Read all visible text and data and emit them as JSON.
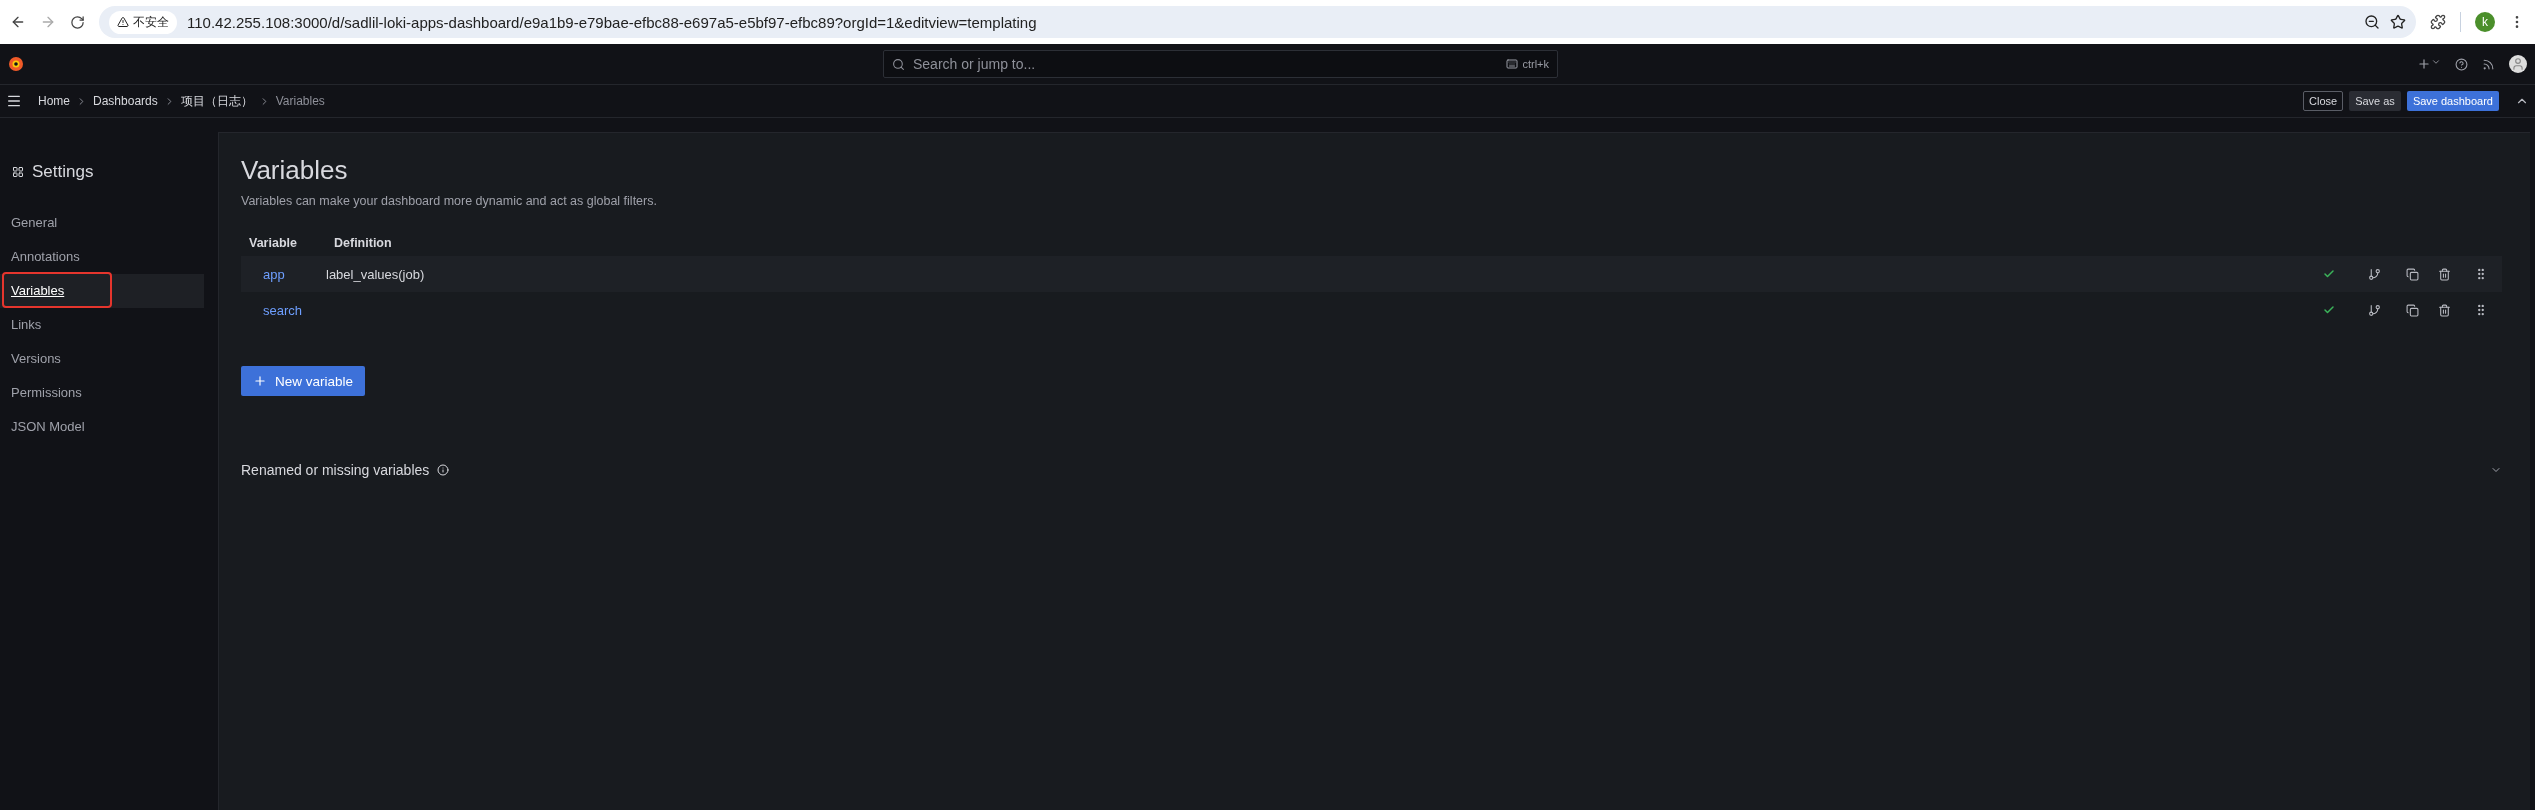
{
  "browser": {
    "security_label": "不安全",
    "url": "110.42.255.108:3000/d/sadlil-loki-apps-dashboard/e9a1b9-e79bae-efbc88-e697a5-e5bf97-efbc89?orgId=1&editview=templating",
    "profile_initial": "k"
  },
  "topbar": {
    "search_placeholder": "Search or jump to...",
    "shortcut": "ctrl+k"
  },
  "breadcrumbs": [
    {
      "label": "Home",
      "current": false
    },
    {
      "label": "Dashboards",
      "current": false
    },
    {
      "label": "项目（日志）",
      "current": false
    },
    {
      "label": "Variables",
      "current": true
    }
  ],
  "actions": [
    {
      "label": "Close",
      "kind": "outline"
    },
    {
      "label": "Save as",
      "kind": "secondary"
    },
    {
      "label": "Save dashboard",
      "kind": "primary"
    }
  ],
  "sidebar": {
    "title": "Settings",
    "items": [
      {
        "label": "General",
        "selected": false,
        "highlighted": false
      },
      {
        "label": "Annotations",
        "selected": false,
        "highlighted": false
      },
      {
        "label": "Variables",
        "selected": true,
        "highlighted": true
      },
      {
        "label": "Links",
        "selected": false,
        "highlighted": false
      },
      {
        "label": "Versions",
        "selected": false,
        "highlighted": false
      },
      {
        "label": "Permissions",
        "selected": false,
        "highlighted": false
      },
      {
        "label": "JSON Model",
        "selected": false,
        "highlighted": false
      }
    ]
  },
  "page": {
    "title": "Variables",
    "description": "Variables can make your dashboard more dynamic and act as global filters.",
    "columns": [
      "Variable",
      "Definition"
    ],
    "rows": [
      {
        "name": "app",
        "definition": "label_values(job)",
        "valid": true
      },
      {
        "name": "search",
        "valid": true
      }
    ],
    "new_button": "New variable",
    "section": {
      "title": "Renamed or missing variables",
      "expanded": false
    }
  }
}
